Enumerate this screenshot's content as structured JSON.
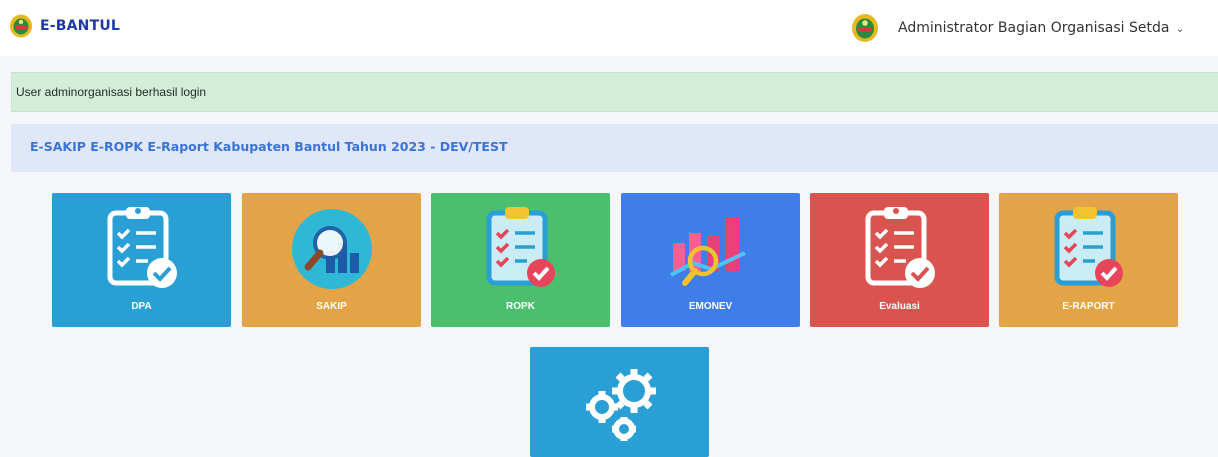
{
  "header": {
    "brand": "E-BANTUL",
    "user_name": "Administrator Bagian Organisasi Setda"
  },
  "alert": {
    "message": "User adminorganisasi berhasil login"
  },
  "info": {
    "title": "E-SAKIP E-ROPK E-Raport Kabupaten Bantul Tahun 2023 - DEV/TEST"
  },
  "tiles": [
    {
      "label": "DPA",
      "color": "#2a9fd6",
      "icon": "clipboard-check-icon"
    },
    {
      "label": "SAKIP",
      "color": "#e3a448",
      "icon": "magnifier-chart-icon"
    },
    {
      "label": "ROPK",
      "color": "#4cbf6e",
      "icon": "clipboard-check-icon"
    },
    {
      "label": "EMONEV",
      "color": "#3f7ee8",
      "icon": "analytics-chart-icon"
    },
    {
      "label": "Evaluasi",
      "color": "#d9534f",
      "icon": "clipboard-check-icon"
    },
    {
      "label": "E-RAPORT",
      "color": "#e3a448",
      "icon": "clipboard-check-icon"
    },
    {
      "label": "",
      "color": "#2a9fd6",
      "icon": "gears-icon"
    }
  ]
}
